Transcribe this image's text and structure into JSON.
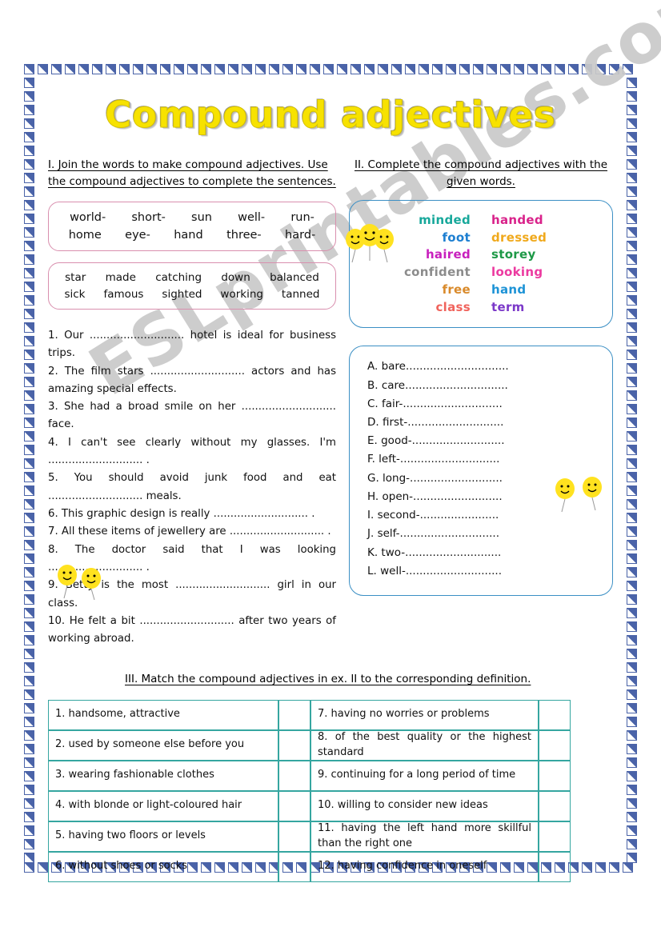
{
  "title": "Compound adjectives",
  "watermark": "ESLprintables.com",
  "exercise1": {
    "instruction_line1": "I. Join the words to make compound adjectives. Use",
    "instruction_line2": "the compound adjectives to complete the sentences.",
    "box1": {
      "row1": [
        "world-",
        "short-",
        "sun",
        "well-",
        "run-"
      ],
      "row2": [
        "home",
        "eye-",
        "hand",
        "three-",
        "hard-"
      ]
    },
    "box2": {
      "row1": [
        "star",
        "made",
        "catching",
        "down",
        "balanced"
      ],
      "row2": [
        "sick",
        "famous",
        "sighted",
        "working",
        "tanned"
      ]
    },
    "sentences": [
      "1. Our ............................ hotel is ideal for business trips.",
      "2. The film stars ............................ actors and has amazing special effects.",
      "3. She had a broad smile on her ............................ face.",
      "4. I can't see clearly without my glasses. I'm ............................ .",
      "5. You should avoid junk food and eat ............................ meals.",
      "6. This graphic design is really ............................ .",
      "7. All these items of jewellery are ............................ .",
      "8. The doctor said that I was looking ............................ .",
      "9. Betty is the most ............................ girl in our class.",
      "10. He felt a bit ............................ after two years of working abroad."
    ]
  },
  "exercise2": {
    "instruction_line1": "II. Complete the compound adjectives with the",
    "instruction_line2": "given words.",
    "words": [
      {
        "text": "minded",
        "color": "#17a89b"
      },
      {
        "text": "handed",
        "color": "#d9228a"
      },
      {
        "text": "foot",
        "color": "#1d7fd1"
      },
      {
        "text": "dressed",
        "color": "#f0a91c"
      },
      {
        "text": "haired",
        "color": "#c81fbd"
      },
      {
        "text": "storey",
        "color": "#1e9947"
      },
      {
        "text": "confident",
        "color": "#8c8c8c"
      },
      {
        "text": "looking",
        "color": "#ec3aa0"
      },
      {
        "text": "free",
        "color": "#d98a2b"
      },
      {
        "text": "hand",
        "color": "#1d93d6"
      },
      {
        "text": "class",
        "color": "#f0635c"
      },
      {
        "text": "term",
        "color": "#7b38c9"
      }
    ],
    "items": [
      "A. bare..............................",
      "B. care..............................",
      "C. fair-.............................",
      "D. first-............................",
      "E. good-...........................",
      "F. left-.............................",
      "G. long-...........................",
      "H. open-..........................",
      "I. second-.......................",
      "J. self-.............................",
      "K. two-............................",
      "L. well-............................"
    ]
  },
  "exercise3": {
    "instruction": "III. Match the compound adjectives in ex. II to the corresponding definition.",
    "definitions_left": [
      "1. handsome, attractive",
      "2. used by someone else before you",
      "3. wearing fashionable clothes",
      "4. with blonde or light-coloured hair",
      "5. having two floors or levels",
      "6. without shoes or socks"
    ],
    "definitions_right": [
      "7. having no worries or problems",
      "8. of the best quality or the highest standard",
      "9. continuing for a long period of time",
      "10. willing to consider new ideas",
      "11. having the left hand more skillful than the right one",
      "12. having confidence in oneself"
    ],
    "answers_left": [
      "",
      "",
      "",
      "",
      "",
      ""
    ],
    "answers_right": [
      "",
      "",
      "",
      "",
      "",
      ""
    ]
  },
  "colors": {
    "title": "#f7e200",
    "border_tile": "#4a63a8",
    "pink_box": "#d98fae",
    "blue_box": "#3b8fc4",
    "table_border": "#35a6a0"
  }
}
